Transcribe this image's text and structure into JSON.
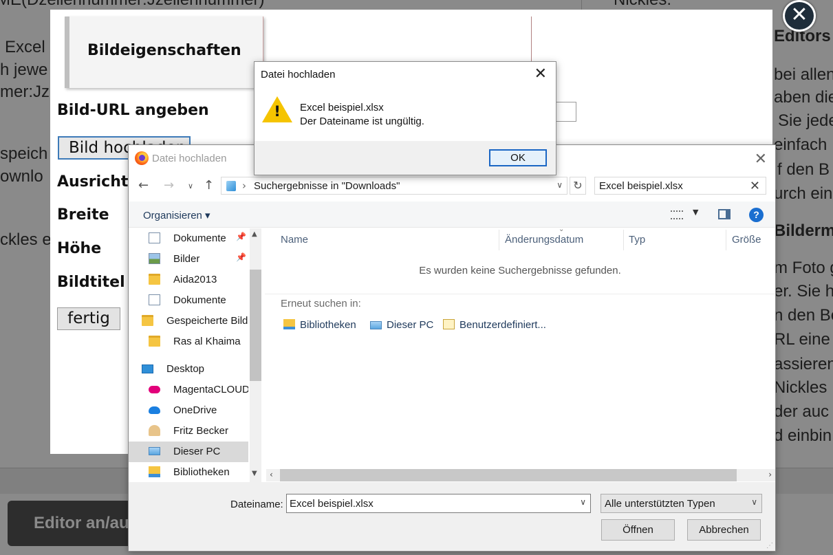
{
  "background": {
    "lines": [
      {
        "text": "ME(Dzeilennummer:Jzeilennummer)",
        "bold": false
      },
      {
        "text": "Nickles.",
        "bold": false
      },
      {
        "text": "Excel",
        "bold": false
      },
      {
        "text": "h jewe",
        "bold": false
      },
      {
        "text": "mer:Jz",
        "bold": false
      },
      {
        "text": "speich",
        "bold": false
      },
      {
        "text": "ownlo",
        "bold": false
      },
      {
        "text": "ckles e",
        "bold": false
      },
      {
        "text": "Editors",
        "bold": true
      },
      {
        "text": "bei allen",
        "bold": false
      },
      {
        "text": "aben die",
        "bold": false
      },
      {
        "text": "Sie jede",
        "bold": false
      },
      {
        "text": "einfach",
        "bold": false
      },
      {
        "text": "f den B",
        "bold": false
      },
      {
        "text": "urch ein",
        "bold": false
      },
      {
        "text": "Bilderm",
        "bold": true
      },
      {
        "text": "m Foto g",
        "bold": false
      },
      {
        "text": "er. Sie h",
        "bold": false
      },
      {
        "text": "n den Be",
        "bold": false
      },
      {
        "text": "RL eine",
        "bold": false
      },
      {
        "text": "assieren",
        "bold": false
      },
      {
        "text": "Nickles",
        "bold": false
      },
      {
        "text": "der auc",
        "bold": false
      },
      {
        "text": "d einbin",
        "bold": false
      }
    ],
    "editor_button": "Editor an/au"
  },
  "modal": {
    "close_icon": "close-icon",
    "tab_label": "Bildeigenschaften",
    "url_label": "Bild-URL angeben",
    "upload_button": "Bild hochladen",
    "align_label": "Ausricht",
    "width_label": "Breite",
    "height_label": "Höhe",
    "title_label": "Bildtitel",
    "done_button": "fertig"
  },
  "message_box": {
    "title": "Datei hochladen",
    "line1": "Excel beispiel.xlsx",
    "line2": "Der Dateiname ist ungültig.",
    "ok": "OK",
    "icon": "warning-icon",
    "warning_mark": "!"
  },
  "file_dialog": {
    "title": "Datei hochladen",
    "address": "Suchergebnisse in \"Downloads\"",
    "search_value": "Excel beispiel.xlsx",
    "organize": "Organisieren ▾",
    "tree": [
      {
        "label": "Dokumente",
        "icon": "document-icon",
        "pinned": true,
        "selected": false
      },
      {
        "label": "Bilder",
        "icon": "pictures-icon",
        "pinned": true,
        "selected": false
      },
      {
        "label": "Aida2013",
        "icon": "folder-icon",
        "pinned": false,
        "selected": false
      },
      {
        "label": "Dokumente",
        "icon": "document-icon",
        "pinned": false,
        "selected": false
      },
      {
        "label": "Gespeicherte Bilder",
        "icon": "shared-folder-icon",
        "pinned": false,
        "selected": false
      },
      {
        "label": "Ras al Khaima",
        "icon": "folder-icon",
        "pinned": false,
        "selected": false
      },
      {
        "label": "Desktop",
        "icon": "desktop-icon",
        "pinned": false,
        "selected": false
      },
      {
        "label": "MagentaCLOUD",
        "icon": "magentacloud-icon",
        "pinned": false,
        "selected": false
      },
      {
        "label": "OneDrive",
        "icon": "onedrive-icon",
        "pinned": false,
        "selected": false
      },
      {
        "label": "Fritz Becker",
        "icon": "user-folder-icon",
        "pinned": false,
        "selected": false
      },
      {
        "label": "Dieser PC",
        "icon": "this-pc-icon",
        "pinned": false,
        "selected": true
      },
      {
        "label": "Bibliotheken",
        "icon": "libraries-icon",
        "pinned": false,
        "selected": false
      }
    ],
    "columns": [
      "Name",
      "Änderungsdatum",
      "Typ",
      "Größe"
    ],
    "no_results": "Es wurden keine Suchergebnisse gefunden.",
    "search_again": "Erneut suchen in:",
    "locations": [
      {
        "label": "Bibliotheken",
        "icon": "libraries-icon"
      },
      {
        "label": "Dieser PC",
        "icon": "this-pc-icon"
      },
      {
        "label": "Benutzerdefiniert...",
        "icon": "custom-search-icon"
      }
    ],
    "filename_label": "Dateiname:",
    "filename_value": "Excel beispiel.xlsx",
    "filetype": "Alle unterstützten Typen",
    "open_button": "Öffnen",
    "cancel_button": "Abbrechen"
  },
  "colors": {
    "accent": "#1a66c4",
    "warning": "#f5c400",
    "selected": "#d9d9d9"
  }
}
